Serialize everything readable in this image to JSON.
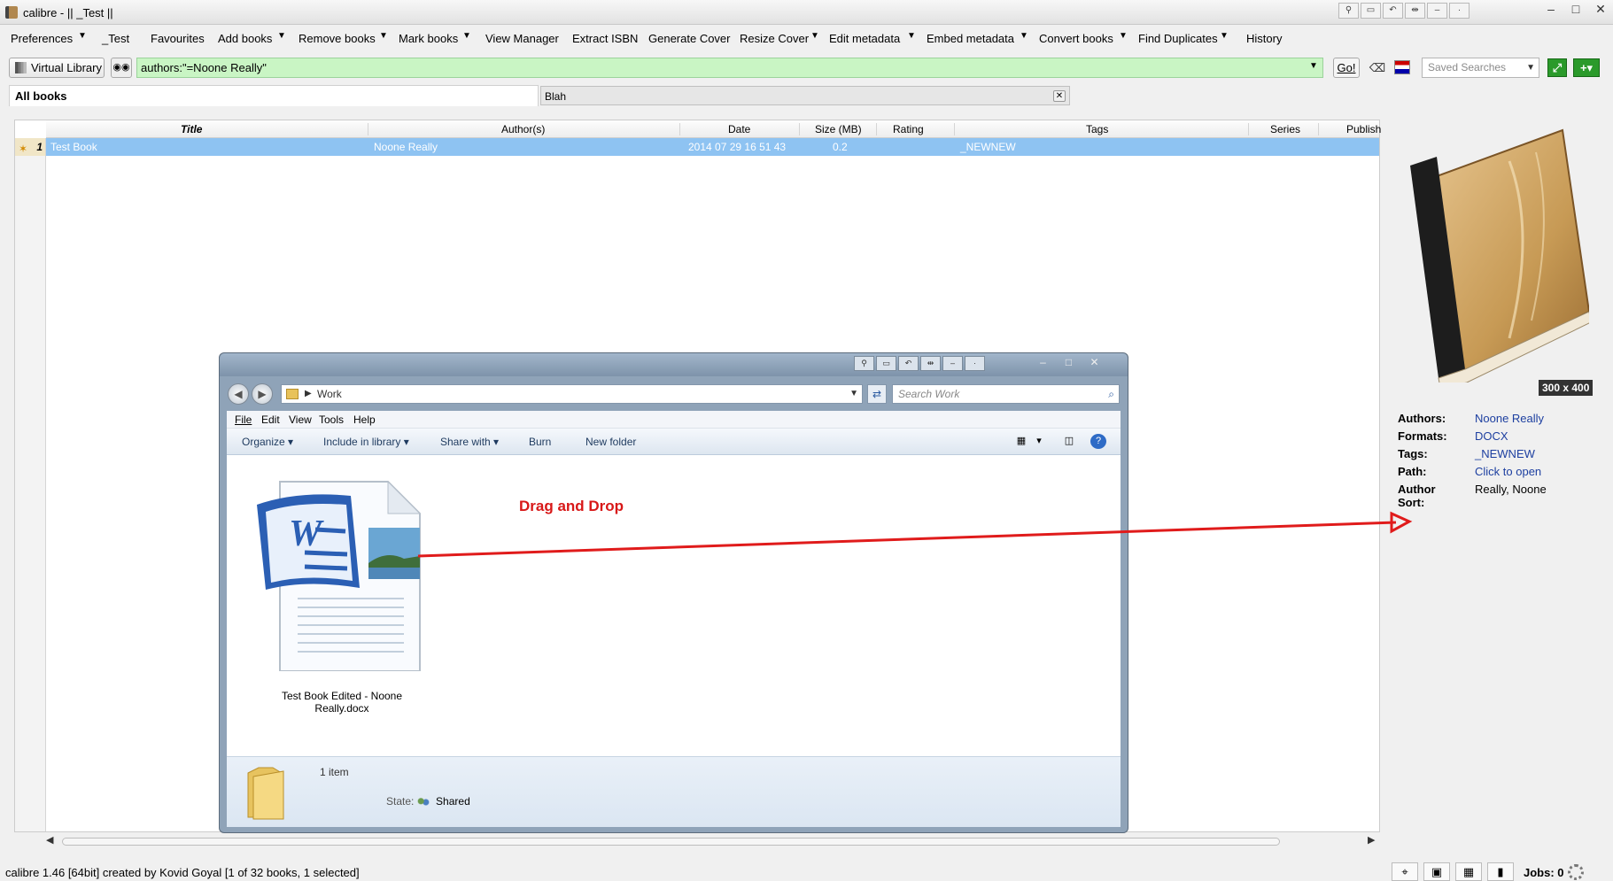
{
  "window": {
    "title": "calibre - || _Test ||"
  },
  "menubar": {
    "items": [
      {
        "label": "Preferences",
        "dropdown": true
      },
      {
        "label": "_Test",
        "dropdown": false
      },
      {
        "label": "Favourites",
        "dropdown": false
      },
      {
        "label": "Add books",
        "dropdown": true
      },
      {
        "label": "Remove books",
        "dropdown": true
      },
      {
        "label": "Mark books",
        "dropdown": true
      },
      {
        "label": "View Manager",
        "dropdown": false
      },
      {
        "label": "Extract ISBN",
        "dropdown": false
      },
      {
        "label": "Generate Cover",
        "dropdown": false
      },
      {
        "label": "Resize Cover",
        "dropdown": true
      },
      {
        "label": "Edit metadata",
        "dropdown": true
      },
      {
        "label": "Embed metadata",
        "dropdown": true
      },
      {
        "label": "Convert books",
        "dropdown": true
      },
      {
        "label": "Find Duplicates",
        "dropdown": true
      },
      {
        "label": "History",
        "dropdown": false
      }
    ]
  },
  "searchbar": {
    "virtual_library_label": "Virtual Library",
    "query": "authors:\"=Noone Really\"",
    "go_label": "Go!",
    "saved_searches_placeholder": "Saved Searches"
  },
  "tabs": {
    "all_books": "All books",
    "blah": "Blah"
  },
  "booklist": {
    "columns": [
      "Title",
      "Author(s)",
      "Date",
      "Size (MB)",
      "Rating",
      "Tags",
      "Series",
      "Publish"
    ],
    "rows": [
      {
        "num": "1",
        "title": "Test Book",
        "authors": "Noone Really",
        "date": "2014 07 29 16 51 43",
        "size": "0.2",
        "rating": "",
        "tags": "_NEWNEW",
        "series": ""
      }
    ]
  },
  "details": {
    "cover_size": "300 x 400",
    "fields": [
      {
        "key": "Authors:",
        "value": "Noone Really",
        "link": true
      },
      {
        "key": "Formats:",
        "value": "DOCX",
        "link": true
      },
      {
        "key": "Tags:",
        "value": "_NEWNEW",
        "link": true
      },
      {
        "key": "Path:",
        "value": "Click to open",
        "link": true
      },
      {
        "key": "Author Sort:",
        "value": "Really, Noone",
        "link": false
      }
    ]
  },
  "statusbar": {
    "text": "calibre 1.46 [64bit] created by Kovid Goyal    [1 of 32 books, 1 selected]",
    "jobs": "Jobs: 0"
  },
  "explorer": {
    "address": "Work",
    "search_placeholder": "Search Work",
    "menu": [
      "File",
      "Edit",
      "View",
      "Tools",
      "Help"
    ],
    "commands": [
      "Organize",
      "Include in library",
      "Share with",
      "Burn",
      "New folder"
    ],
    "file_name": "Test Book Edited - Noone Really.docx",
    "annotation": "Drag and Drop",
    "item_count": "1 item",
    "state_label": "State:",
    "state_value": "Shared"
  },
  "colors": {
    "selection": "#8ec3f2",
    "search_bg": "#c9f5c4",
    "annotation": "#d81818",
    "link": "#1d3fa0"
  }
}
